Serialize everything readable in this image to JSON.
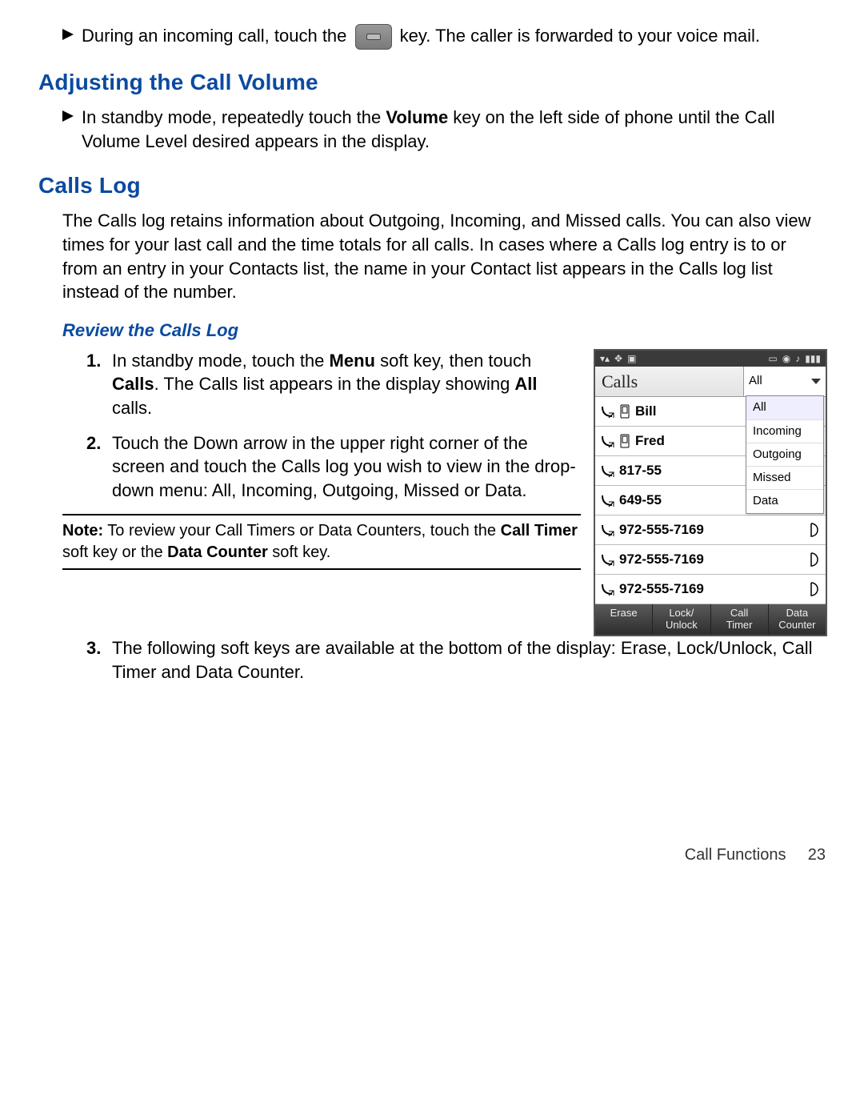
{
  "intro": {
    "pre": "During an incoming call, touch the ",
    "post": " key. The caller is forwarded to your voice mail."
  },
  "section1": {
    "heading": "Adjusting the Call Volume",
    "bullet_pre": "In standby mode, repeatedly touch the ",
    "bullet_bold": "Volume",
    "bullet_post": " key on the left side of phone until the Call Volume Level desired appears in the display."
  },
  "section2": {
    "heading": "Calls Log",
    "para": "The Calls log retains information about Outgoing, Incoming, and Missed calls. You can also view times for your last call and the time totals for all calls. In cases where a Calls log entry is to or from an entry in your Contacts list, the name in your Contact list appears in the Calls log list instead of the number."
  },
  "review": {
    "heading": "Review the Calls Log",
    "steps": {
      "s1": {
        "num": "1.",
        "a": "In standby mode, touch the ",
        "b": "Menu",
        "c": " soft key, then touch ",
        "d": "Calls",
        "e": ". The Calls list appears in the display showing ",
        "f": "All",
        "g": " calls."
      },
      "s2": {
        "num": "2.",
        "text": "Touch the Down arrow in the upper right corner of the screen and touch the Calls log you wish to view in the drop-down menu: All, Incoming, Outgoing, Missed or Data."
      },
      "s3": {
        "num": "3.",
        "text": "The following soft keys are available at the bottom of the display: Erase, Lock/Unlock, Call Timer and Data Counter."
      }
    }
  },
  "note": {
    "label": "Note:",
    "a": " To review your Call Timers or Data Counters, touch the ",
    "b": "Call Timer",
    "c": " soft key or the ",
    "d": "Data Counter",
    "e": " soft key."
  },
  "phone": {
    "title": "Calls",
    "dd_selected": "All",
    "dropdown": [
      "All",
      "Incoming",
      "Outgoing",
      "Missed",
      "Data"
    ],
    "rows": [
      {
        "label": "Bill",
        "contact": true,
        "vm": false
      },
      {
        "label": "Fred",
        "contact": true,
        "vm": false
      },
      {
        "label": "817-55",
        "contact": false,
        "vm": false
      },
      {
        "label": "649-55",
        "contact": false,
        "vm": false
      },
      {
        "label": "972-555-7169",
        "contact": false,
        "vm": true
      },
      {
        "label": "972-555-7169",
        "contact": false,
        "vm": true
      },
      {
        "label": "972-555-7169",
        "contact": false,
        "vm": true
      }
    ],
    "softkeys": [
      "Erase",
      "Lock/\nUnlock",
      "Call\nTimer",
      "Data\nCounter"
    ]
  },
  "footer": {
    "section": "Call Functions",
    "page": "23"
  }
}
